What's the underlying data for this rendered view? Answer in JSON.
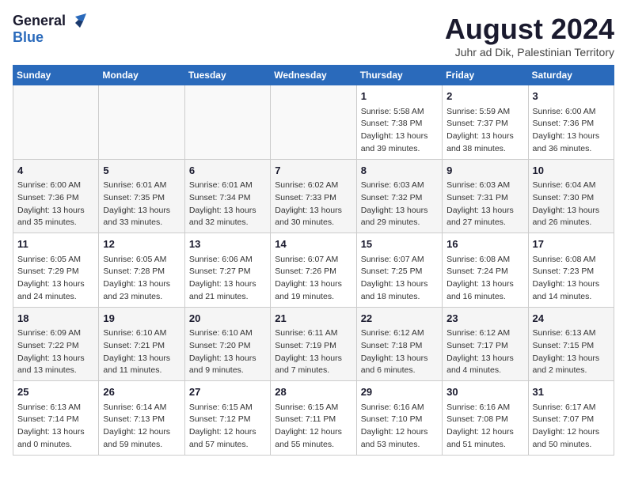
{
  "header": {
    "logo_general": "General",
    "logo_blue": "Blue",
    "title": "August 2024",
    "subtitle": "Juhr ad Dik, Palestinian Territory"
  },
  "weekdays": [
    "Sunday",
    "Monday",
    "Tuesday",
    "Wednesday",
    "Thursday",
    "Friday",
    "Saturday"
  ],
  "weeks": [
    [
      {
        "day": "",
        "info": ""
      },
      {
        "day": "",
        "info": ""
      },
      {
        "day": "",
        "info": ""
      },
      {
        "day": "",
        "info": ""
      },
      {
        "day": "1",
        "info": "Sunrise: 5:58 AM\nSunset: 7:38 PM\nDaylight: 13 hours\nand 39 minutes."
      },
      {
        "day": "2",
        "info": "Sunrise: 5:59 AM\nSunset: 7:37 PM\nDaylight: 13 hours\nand 38 minutes."
      },
      {
        "day": "3",
        "info": "Sunrise: 6:00 AM\nSunset: 7:36 PM\nDaylight: 13 hours\nand 36 minutes."
      }
    ],
    [
      {
        "day": "4",
        "info": "Sunrise: 6:00 AM\nSunset: 7:36 PM\nDaylight: 13 hours\nand 35 minutes."
      },
      {
        "day": "5",
        "info": "Sunrise: 6:01 AM\nSunset: 7:35 PM\nDaylight: 13 hours\nand 33 minutes."
      },
      {
        "day": "6",
        "info": "Sunrise: 6:01 AM\nSunset: 7:34 PM\nDaylight: 13 hours\nand 32 minutes."
      },
      {
        "day": "7",
        "info": "Sunrise: 6:02 AM\nSunset: 7:33 PM\nDaylight: 13 hours\nand 30 minutes."
      },
      {
        "day": "8",
        "info": "Sunrise: 6:03 AM\nSunset: 7:32 PM\nDaylight: 13 hours\nand 29 minutes."
      },
      {
        "day": "9",
        "info": "Sunrise: 6:03 AM\nSunset: 7:31 PM\nDaylight: 13 hours\nand 27 minutes."
      },
      {
        "day": "10",
        "info": "Sunrise: 6:04 AM\nSunset: 7:30 PM\nDaylight: 13 hours\nand 26 minutes."
      }
    ],
    [
      {
        "day": "11",
        "info": "Sunrise: 6:05 AM\nSunset: 7:29 PM\nDaylight: 13 hours\nand 24 minutes."
      },
      {
        "day": "12",
        "info": "Sunrise: 6:05 AM\nSunset: 7:28 PM\nDaylight: 13 hours\nand 23 minutes."
      },
      {
        "day": "13",
        "info": "Sunrise: 6:06 AM\nSunset: 7:27 PM\nDaylight: 13 hours\nand 21 minutes."
      },
      {
        "day": "14",
        "info": "Sunrise: 6:07 AM\nSunset: 7:26 PM\nDaylight: 13 hours\nand 19 minutes."
      },
      {
        "day": "15",
        "info": "Sunrise: 6:07 AM\nSunset: 7:25 PM\nDaylight: 13 hours\nand 18 minutes."
      },
      {
        "day": "16",
        "info": "Sunrise: 6:08 AM\nSunset: 7:24 PM\nDaylight: 13 hours\nand 16 minutes."
      },
      {
        "day": "17",
        "info": "Sunrise: 6:08 AM\nSunset: 7:23 PM\nDaylight: 13 hours\nand 14 minutes."
      }
    ],
    [
      {
        "day": "18",
        "info": "Sunrise: 6:09 AM\nSunset: 7:22 PM\nDaylight: 13 hours\nand 13 minutes."
      },
      {
        "day": "19",
        "info": "Sunrise: 6:10 AM\nSunset: 7:21 PM\nDaylight: 13 hours\nand 11 minutes."
      },
      {
        "day": "20",
        "info": "Sunrise: 6:10 AM\nSunset: 7:20 PM\nDaylight: 13 hours\nand 9 minutes."
      },
      {
        "day": "21",
        "info": "Sunrise: 6:11 AM\nSunset: 7:19 PM\nDaylight: 13 hours\nand 7 minutes."
      },
      {
        "day": "22",
        "info": "Sunrise: 6:12 AM\nSunset: 7:18 PM\nDaylight: 13 hours\nand 6 minutes."
      },
      {
        "day": "23",
        "info": "Sunrise: 6:12 AM\nSunset: 7:17 PM\nDaylight: 13 hours\nand 4 minutes."
      },
      {
        "day": "24",
        "info": "Sunrise: 6:13 AM\nSunset: 7:15 PM\nDaylight: 13 hours\nand 2 minutes."
      }
    ],
    [
      {
        "day": "25",
        "info": "Sunrise: 6:13 AM\nSunset: 7:14 PM\nDaylight: 13 hours\nand 0 minutes."
      },
      {
        "day": "26",
        "info": "Sunrise: 6:14 AM\nSunset: 7:13 PM\nDaylight: 12 hours\nand 59 minutes."
      },
      {
        "day": "27",
        "info": "Sunrise: 6:15 AM\nSunset: 7:12 PM\nDaylight: 12 hours\nand 57 minutes."
      },
      {
        "day": "28",
        "info": "Sunrise: 6:15 AM\nSunset: 7:11 PM\nDaylight: 12 hours\nand 55 minutes."
      },
      {
        "day": "29",
        "info": "Sunrise: 6:16 AM\nSunset: 7:10 PM\nDaylight: 12 hours\nand 53 minutes."
      },
      {
        "day": "30",
        "info": "Sunrise: 6:16 AM\nSunset: 7:08 PM\nDaylight: 12 hours\nand 51 minutes."
      },
      {
        "day": "31",
        "info": "Sunrise: 6:17 AM\nSunset: 7:07 PM\nDaylight: 12 hours\nand 50 minutes."
      }
    ]
  ]
}
